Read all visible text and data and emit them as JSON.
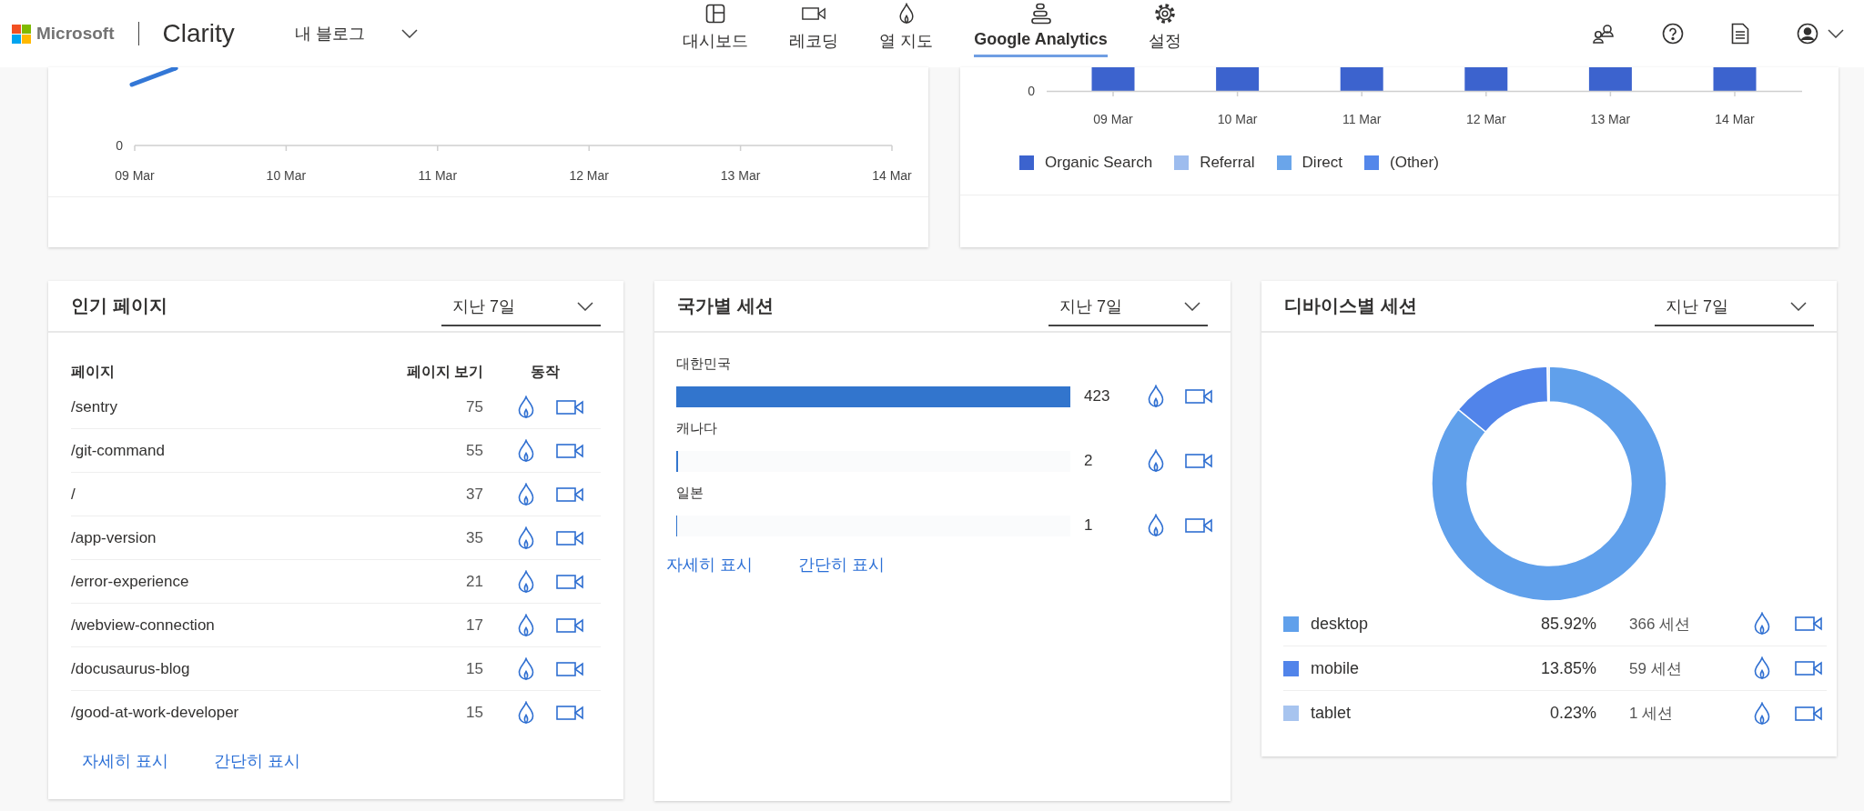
{
  "header": {
    "brand": "Microsoft",
    "product": "Clarity",
    "project": "내 블로그",
    "nav": [
      {
        "kind": "dashboard",
        "label": "대시보드",
        "selected": false
      },
      {
        "kind": "recordings",
        "label": "레코딩",
        "selected": false
      },
      {
        "kind": "heatmaps",
        "label": "열 지도",
        "selected": false
      },
      {
        "kind": "analytics",
        "label": "Google Analytics",
        "selected": true
      },
      {
        "kind": "settings",
        "label": "설정",
        "selected": false
      }
    ]
  },
  "traffic_chart": {
    "y_tick": "0",
    "x_labels": [
      "09 Mar",
      "10 Mar",
      "11 Mar",
      "12 Mar",
      "13 Mar",
      "14 Mar"
    ]
  },
  "channel_chart": {
    "y_tick": "0",
    "x_labels": [
      "09 Mar",
      "10 Mar",
      "11 Mar",
      "12 Mar",
      "13 Mar",
      "14 Mar"
    ],
    "legend": [
      {
        "label": "Organic Search",
        "color": "#3c63ce"
      },
      {
        "label": "Referral",
        "color": "#9dbcee"
      },
      {
        "label": "Direct",
        "color": "#6aa5ea"
      },
      {
        "label": "(Other)",
        "color": "#5487ea"
      }
    ]
  },
  "popular_pages": {
    "title": "인기 페이지",
    "period": "지난 7일",
    "columns": [
      "페이지",
      "페이지 보기",
      "동작"
    ],
    "rows": [
      {
        "page": "/sentry",
        "views": "75"
      },
      {
        "page": "/git-command",
        "views": "55"
      },
      {
        "page": "/",
        "views": "37"
      },
      {
        "page": "/app-version",
        "views": "35"
      },
      {
        "page": "/error-experience",
        "views": "21"
      },
      {
        "page": "/webview-connection",
        "views": "17"
      },
      {
        "page": "/docusaurus-blog",
        "views": "15"
      },
      {
        "page": "/good-at-work-developer",
        "views": "15"
      }
    ],
    "links": [
      "자세히 표시",
      "간단히 표시"
    ]
  },
  "country_sessions": {
    "title": "국가별 세션",
    "period": "지난 7일",
    "rows": [
      {
        "country": "대한민국",
        "count": "423",
        "level": 1
      },
      {
        "country": "캐나다",
        "count": "2",
        "level": 0.0047
      },
      {
        "country": "일본",
        "count": "1",
        "level": 0.0024
      }
    ],
    "links": [
      "자세히 표시",
      "간단히 표시"
    ]
  },
  "device_sessions": {
    "title": "디바이스별 세션",
    "period": "지난 7일",
    "chart_data": {
      "type": "donut",
      "categories": [
        "desktop",
        "mobile",
        "tablet"
      ],
      "values": [
        85.92,
        13.85,
        0.23
      ]
    },
    "rows": [
      {
        "color": "#60a0eb",
        "percent": "85.92%",
        "sessions": "366 세션"
      },
      {
        "color": "#5184ea",
        "percent": "13.85%",
        "sessions": "59 세션"
      },
      {
        "color": "#a7c4ef",
        "percent": "0.23%",
        "sessions": "1 세션"
      }
    ]
  }
}
